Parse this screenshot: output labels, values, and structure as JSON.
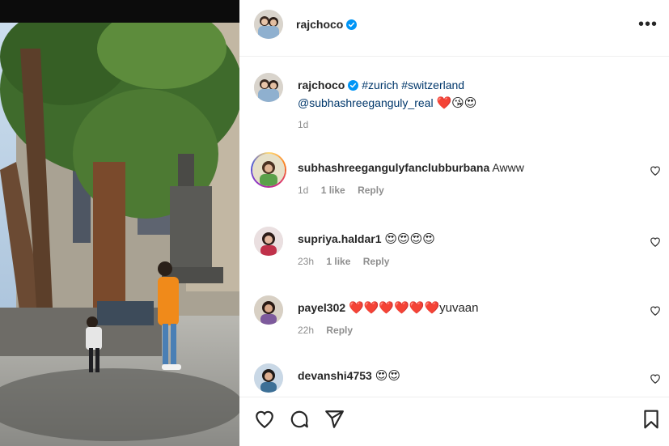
{
  "post": {
    "author": "rajchoco",
    "verified": true,
    "more_label": "•••"
  },
  "caption": {
    "author": "rajchoco",
    "hashtags": [
      "#zurich",
      "#switzerland"
    ],
    "mention": "@subhashreeganguly_real",
    "emojis": "❤️😘😍",
    "time": "1d"
  },
  "comments": [
    {
      "username": "subhashreegangulyfanclubburbana",
      "text": "Awww",
      "time": "1d",
      "likes": "1 like",
      "reply": "Reply",
      "story_ring": true
    },
    {
      "username": "supriya.haldar1",
      "text": "😍😍😍😍",
      "time": "23h",
      "likes": "1 like",
      "reply": "Reply",
      "story_ring": false
    },
    {
      "username": "payel302",
      "text": "❤️❤️❤️❤️❤️❤️yuvaan",
      "time": "22h",
      "likes": "",
      "reply": "Reply",
      "story_ring": false
    },
    {
      "username": "devanshi4753",
      "text": "😍😍",
      "time": "",
      "likes": "",
      "reply": "",
      "story_ring": false
    }
  ],
  "icons": {
    "like": "heart-icon",
    "comment": "comment-icon",
    "share": "paper-plane-icon",
    "save": "bookmark-icon",
    "verified": "verified-badge-icon",
    "more": "more-options-icon"
  },
  "colors": {
    "verified_blue": "#0095f6",
    "link_blue": "#00376b",
    "muted": "#8e8e8e",
    "text": "#262626"
  }
}
